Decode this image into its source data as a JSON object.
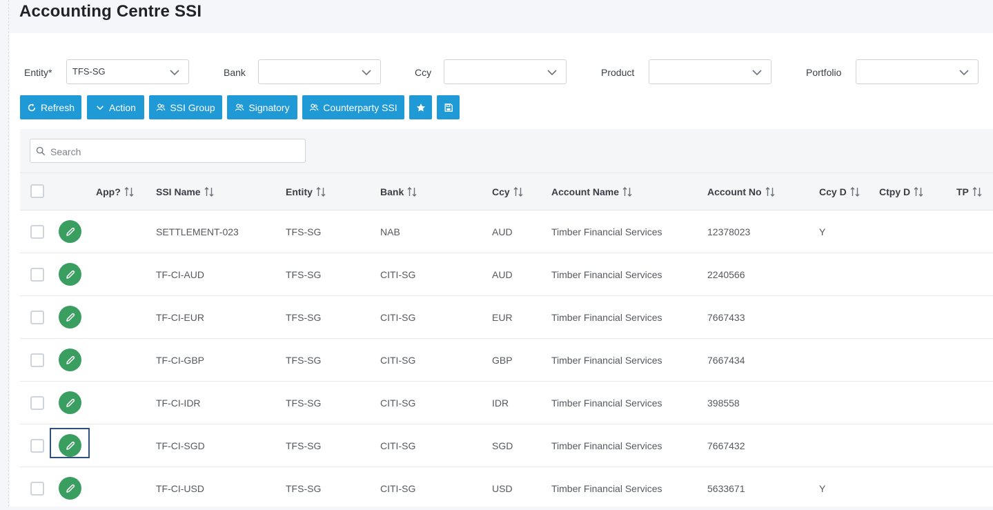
{
  "page": {
    "title": "Accounting Centre SSI"
  },
  "filters": {
    "entity": {
      "label": "Entity*",
      "value": "TFS-SG"
    },
    "bank": {
      "label": "Bank",
      "value": ""
    },
    "ccy": {
      "label": "Ccy",
      "value": ""
    },
    "product": {
      "label": "Product",
      "value": ""
    },
    "portfolio": {
      "label": "Portfolio",
      "value": ""
    }
  },
  "toolbar": {
    "refresh": "Refresh",
    "action": "Action",
    "ssi_group": "SSI Group",
    "signatory": "Signatory",
    "counterparty_ssi": "Counterparty SSI",
    "favorite_icon": "star-icon",
    "save_icon": "save-icon"
  },
  "search": {
    "placeholder": "Search",
    "value": ""
  },
  "table": {
    "headers": {
      "app": "App?",
      "ssi_name": "SSI Name",
      "entity": "Entity",
      "bank": "Bank",
      "ccy": "Ccy",
      "account_name": "Account Name",
      "account_no": "Account No",
      "ccy_d": "Ccy D",
      "ctpy_d": "Ctpy D",
      "tp": "TP"
    },
    "rows": [
      {
        "ssi_name": "SETTLEMENT-023",
        "entity": "TFS-SG",
        "bank": "NAB",
        "ccy": "AUD",
        "account_name": "Timber Financial Services",
        "account_no": "12378023",
        "ccy_d": "Y",
        "ctpy_d": "",
        "tp": ""
      },
      {
        "ssi_name": "TF-CI-AUD",
        "entity": "TFS-SG",
        "bank": "CITI-SG",
        "ccy": "AUD",
        "account_name": "Timber Financial Services",
        "account_no": "2240566",
        "ccy_d": "",
        "ctpy_d": "",
        "tp": ""
      },
      {
        "ssi_name": "TF-CI-EUR",
        "entity": "TFS-SG",
        "bank": "CITI-SG",
        "ccy": "EUR",
        "account_name": "Timber Financial Services",
        "account_no": "7667433",
        "ccy_d": "",
        "ctpy_d": "",
        "tp": ""
      },
      {
        "ssi_name": "TF-CI-GBP",
        "entity": "TFS-SG",
        "bank": "CITI-SG",
        "ccy": "GBP",
        "account_name": "Timber Financial Services",
        "account_no": "7667434",
        "ccy_d": "",
        "ctpy_d": "",
        "tp": ""
      },
      {
        "ssi_name": "TF-CI-IDR",
        "entity": "TFS-SG",
        "bank": "CITI-SG",
        "ccy": "IDR",
        "account_name": "Timber Financial Services",
        "account_no": "398558",
        "ccy_d": "",
        "ctpy_d": "",
        "tp": ""
      },
      {
        "ssi_name": "TF-CI-SGD",
        "entity": "TFS-SG",
        "bank": "CITI-SG",
        "ccy": "SGD",
        "account_name": "Timber Financial Services",
        "account_no": "7667432",
        "ccy_d": "",
        "ctpy_d": "",
        "tp": ""
      },
      {
        "ssi_name": "TF-CI-USD",
        "entity": "TFS-SG",
        "bank": "CITI-SG",
        "ccy": "USD",
        "account_name": "Timber Financial Services",
        "account_no": "5633671",
        "ccy_d": "Y",
        "ctpy_d": "",
        "tp": ""
      }
    ]
  },
  "colors": {
    "primary_button": "#1f9ad6",
    "edit_button": "#3a9e61",
    "focus_outline": "#2f4f7f",
    "page_background": "#f4f6f9"
  }
}
